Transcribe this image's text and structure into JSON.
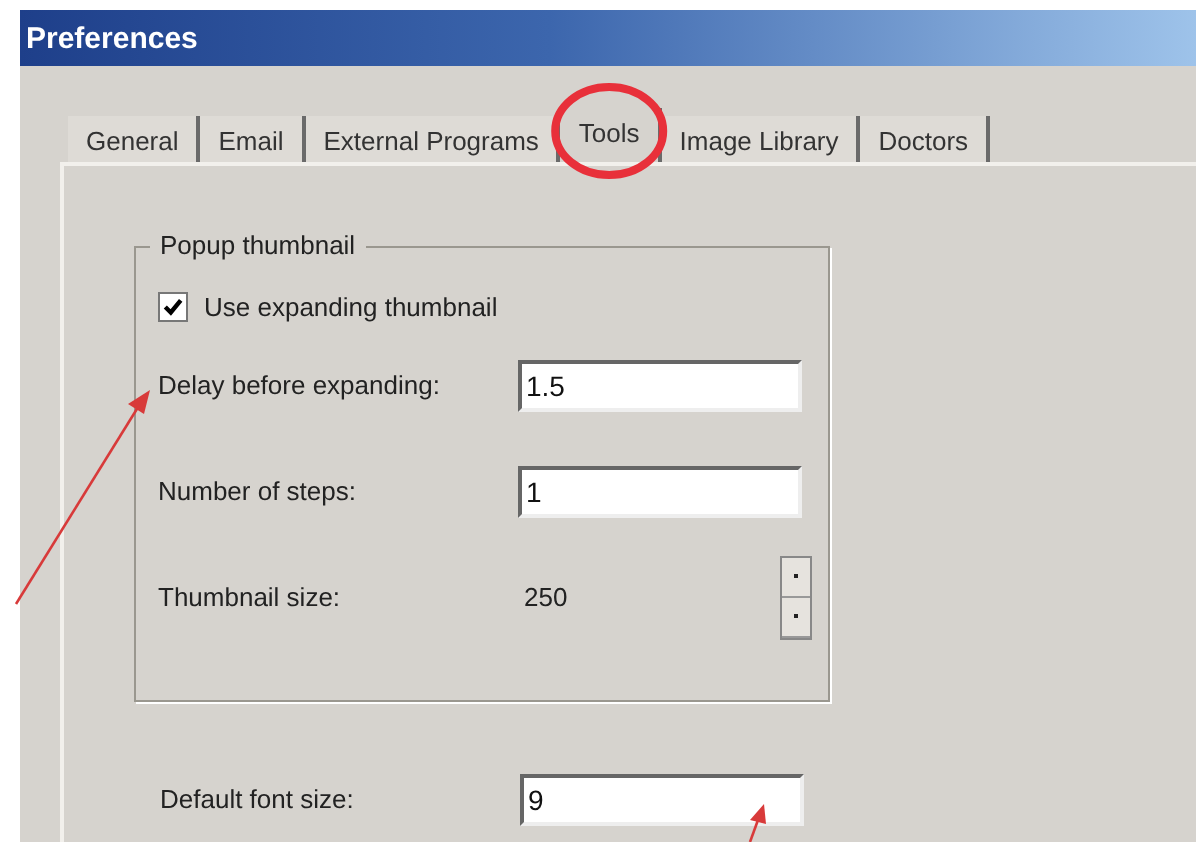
{
  "window": {
    "title": "Preferences"
  },
  "tabs": [
    {
      "label": "General",
      "selected": false
    },
    {
      "label": "Email",
      "selected": false
    },
    {
      "label": "External Programs",
      "selected": false
    },
    {
      "label": "Tools",
      "selected": true
    },
    {
      "label": "Image Library",
      "selected": false
    },
    {
      "label": "Doctors",
      "selected": false
    }
  ],
  "group": {
    "title": "Popup thumbnail",
    "checkbox": {
      "label": "Use expanding thumbnail",
      "checked": true
    },
    "rows": [
      {
        "kind": "input",
        "label": "Delay before expanding:",
        "value": "1.5"
      },
      {
        "kind": "input",
        "label": "Number of steps:",
        "value": "1"
      },
      {
        "kind": "spinner",
        "label": "Thumbnail size:",
        "value": "250"
      }
    ]
  },
  "rows": [
    {
      "kind": "input",
      "label": "Default font size:",
      "value": "9"
    }
  ]
}
